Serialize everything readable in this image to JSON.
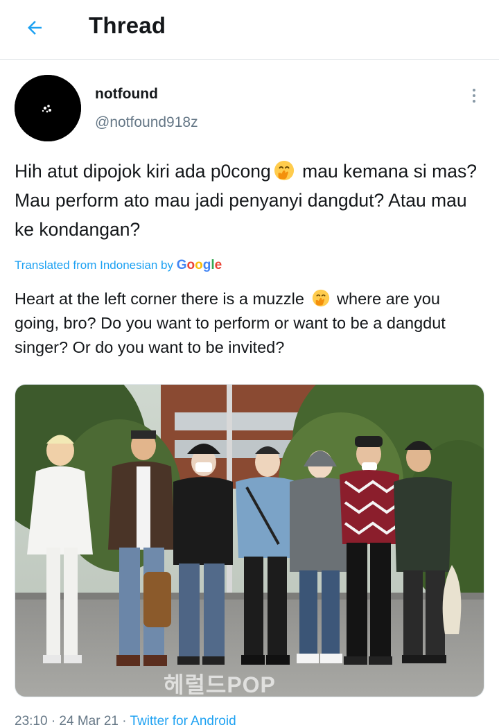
{
  "header": {
    "back_icon": "arrow-left-icon",
    "title": "Thread"
  },
  "tweet": {
    "author": {
      "display_name": "notfound",
      "handle": "@notfound918z",
      "avatar_bg": "#000000"
    },
    "more_icon": "vertical-dots-icon",
    "text_before_emoji": "Hih atut dipojok kiri ada p0cong",
    "text_after_emoji": " mau kemana si mas? Mau perform ato mau jadi penyanyi dangdut? Atau mau ke kondangan?",
    "emoji_icon": "hand-over-mouth-emoji",
    "translation_label": "Translated from Indonesian by ",
    "translation_provider": [
      "G",
      "o",
      "o",
      "g",
      "l",
      "e"
    ],
    "translation_before_emoji": "Heart at the left corner there is a muzzle ",
    "translation_after_emoji": " where are you going, bro? Do you want to perform or want to be a dangdut singer? Or do you want to be invited?",
    "media": {
      "watermark": "헤럴드POP",
      "people_count": 7
    },
    "time": "23:10 · 24 Mar 21 · ",
    "source": "Twitter for Android"
  },
  "colors": {
    "accent": "#1da1f2",
    "secondary_text": "#657786",
    "primary_text": "#14171a"
  }
}
